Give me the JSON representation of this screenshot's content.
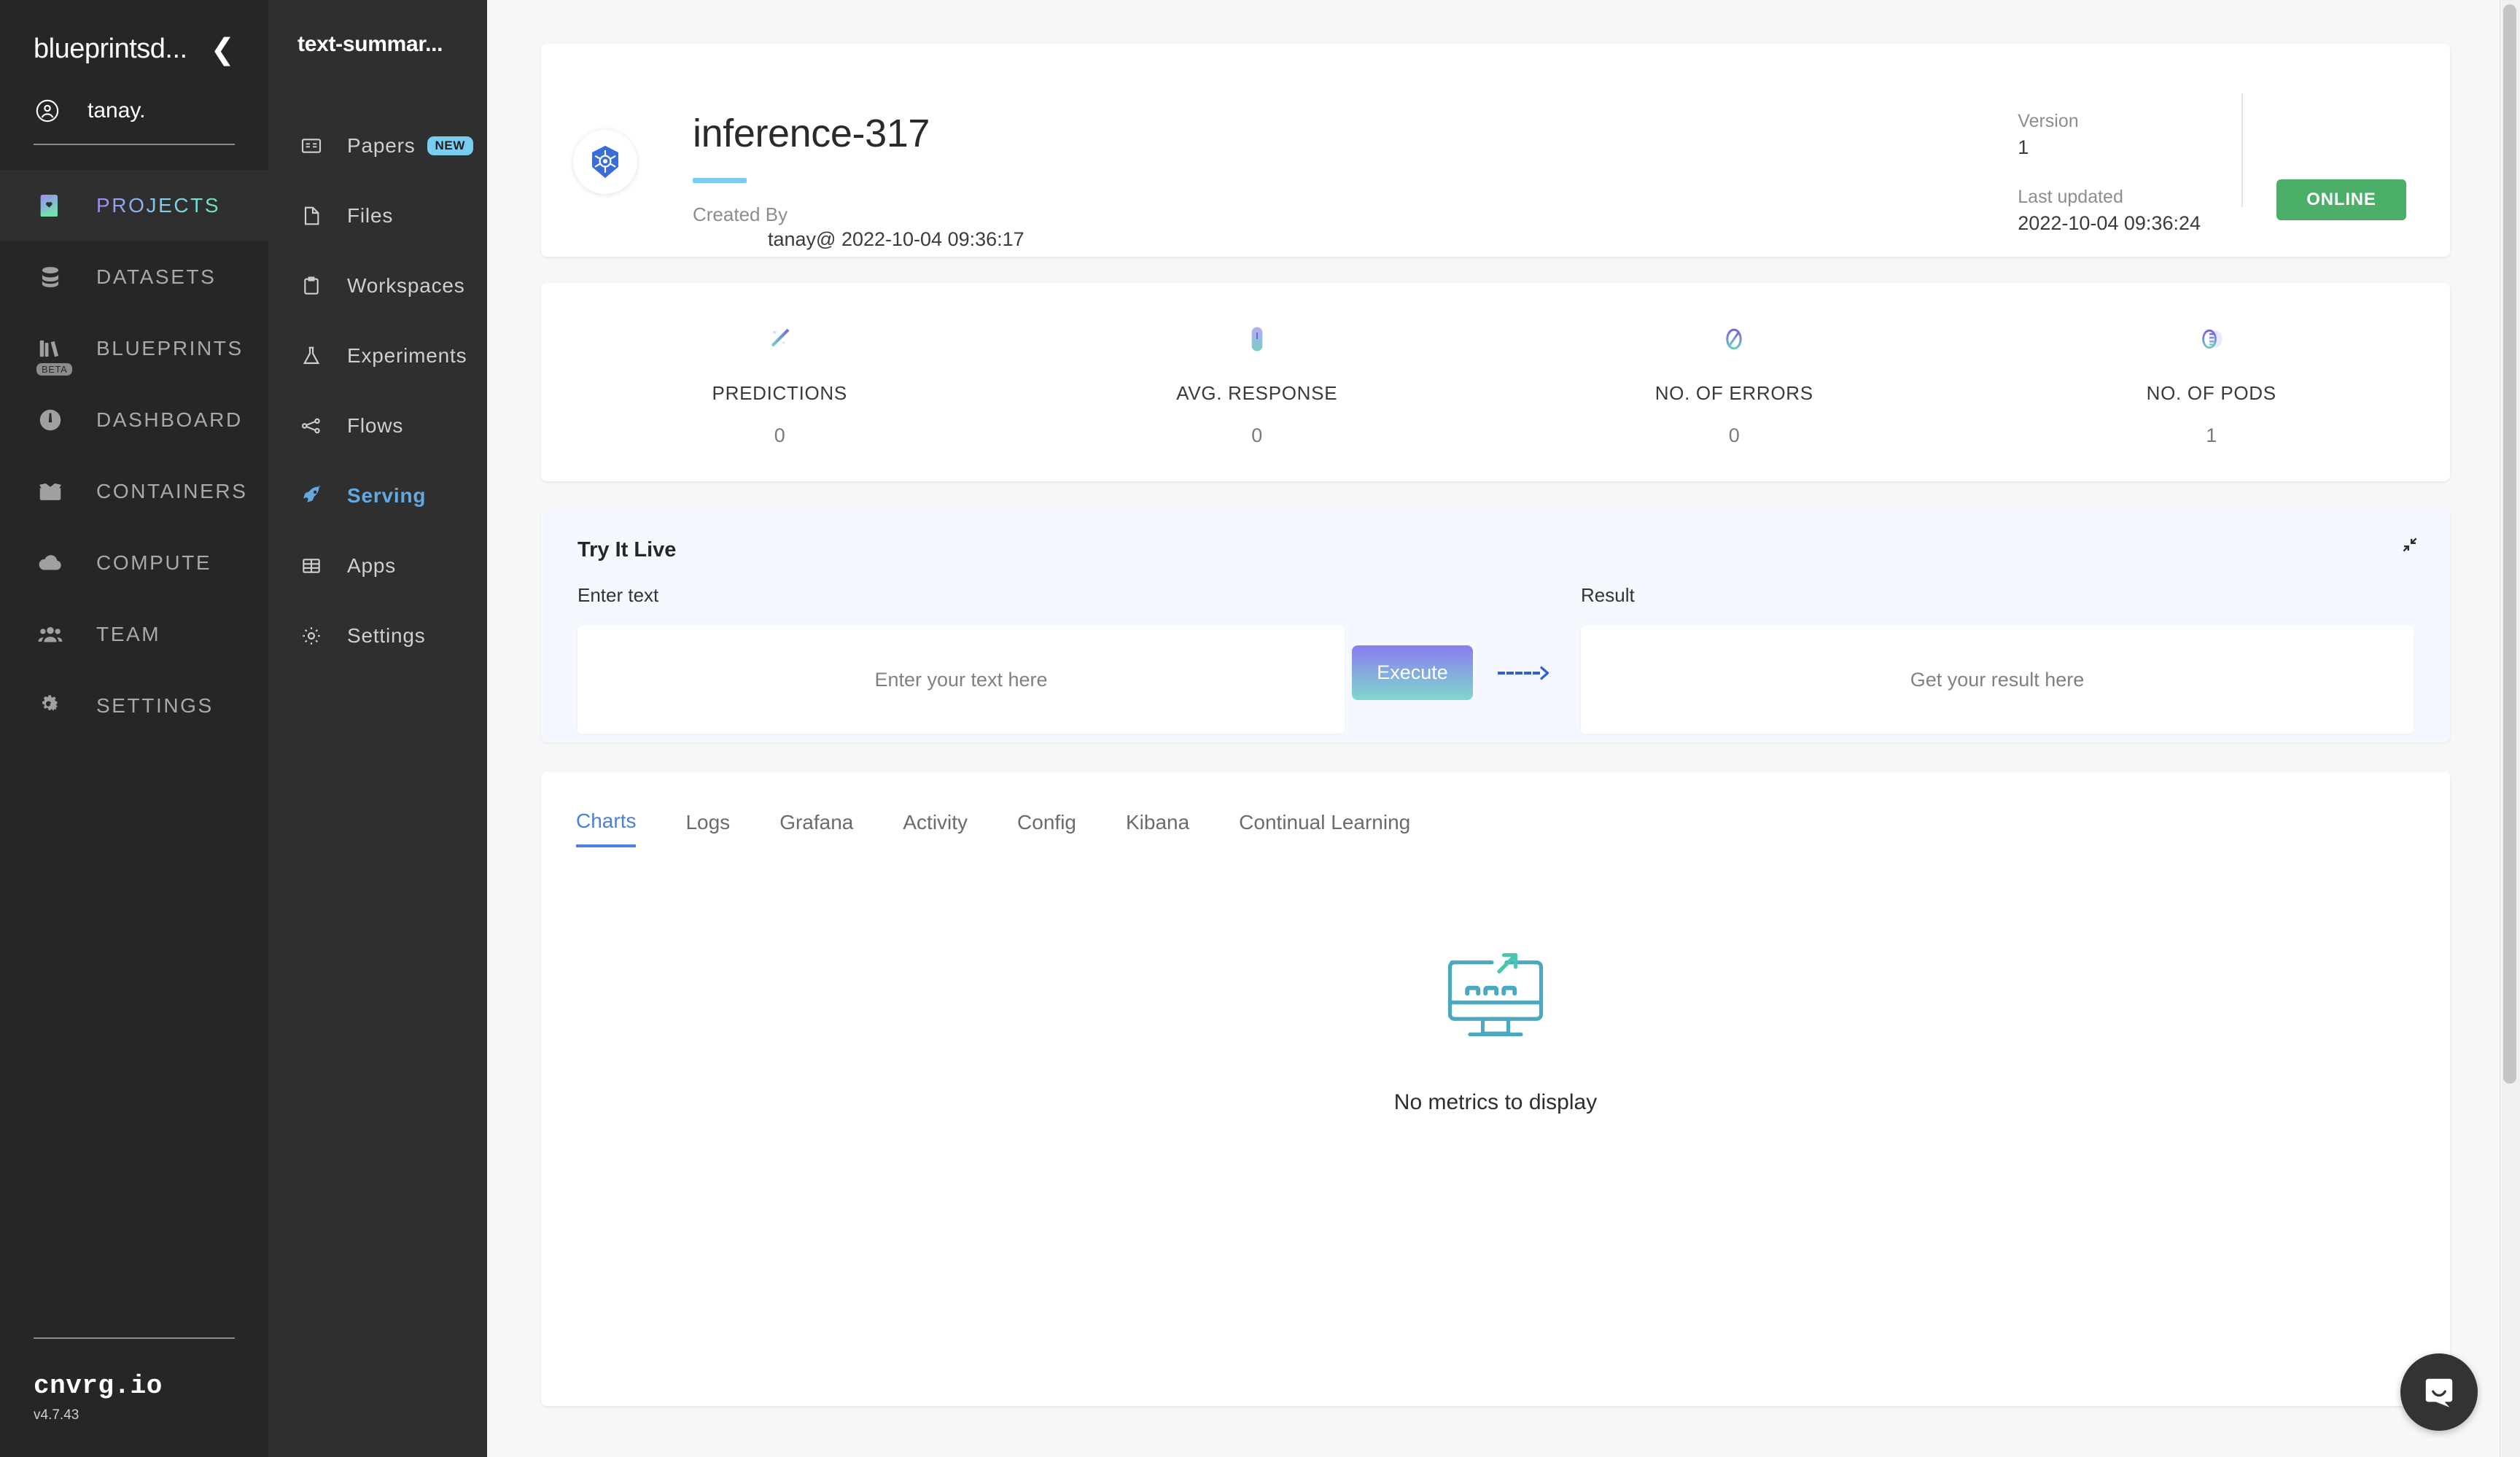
{
  "primary_sidebar": {
    "org_name": "blueprintsd...",
    "collapse_icon": "chevron-left-icon",
    "user_name": "tanay.",
    "items": [
      {
        "label": "PROJECTS",
        "icon": "book-heart-icon",
        "active": true,
        "badge": ""
      },
      {
        "label": "DATASETS",
        "icon": "database-icon",
        "active": false,
        "badge": ""
      },
      {
        "label": "BLUEPRINTS",
        "icon": "books-icon",
        "active": false,
        "badge": "BETA"
      },
      {
        "label": "DASHBOARD",
        "icon": "gauge-icon",
        "active": false,
        "badge": ""
      },
      {
        "label": "CONTAINERS",
        "icon": "box-icon",
        "active": false,
        "badge": ""
      },
      {
        "label": "COMPUTE",
        "icon": "cloud-icon",
        "active": false,
        "badge": ""
      },
      {
        "label": "TEAM",
        "icon": "people-icon",
        "active": false,
        "badge": ""
      },
      {
        "label": "SETTINGS",
        "icon": "gears-icon",
        "active": false,
        "badge": ""
      }
    ],
    "brand": "cnvrg.io",
    "version": "v4.7.43"
  },
  "secondary_sidebar": {
    "project_title": "text-summar...",
    "items": [
      {
        "label": "Papers",
        "icon": "papers-icon",
        "active": false,
        "badge": "NEW"
      },
      {
        "label": "Files",
        "icon": "file-icon",
        "active": false,
        "badge": ""
      },
      {
        "label": "Workspaces",
        "icon": "workspace-icon",
        "active": false,
        "badge": ""
      },
      {
        "label": "Experiments",
        "icon": "flask-icon",
        "active": false,
        "badge": ""
      },
      {
        "label": "Flows",
        "icon": "flow-icon",
        "active": false,
        "badge": ""
      },
      {
        "label": "Serving",
        "icon": "rocket-icon",
        "active": true,
        "badge": ""
      },
      {
        "label": "Apps",
        "icon": "grid-table-icon",
        "active": false,
        "badge": ""
      },
      {
        "label": "Settings",
        "icon": "gear-icon",
        "active": false,
        "badge": ""
      }
    ]
  },
  "header": {
    "avatar_icon": "kubernetes-icon",
    "title": "inference-317",
    "created_by_label": "Created By",
    "created_by_value": "tanay@ 2022-10-04 09:36:17",
    "version_label": "Version",
    "version_value": "1",
    "last_updated_label": "Last updated",
    "last_updated_value": "2022-10-04 09:36:24",
    "status": "ONLINE",
    "status_color": "#4caf68"
  },
  "stats": [
    {
      "label": "PREDICTIONS",
      "value": "0",
      "icon": "magic-wand-icon"
    },
    {
      "label": "AVG. RESPONSE",
      "value": "0",
      "icon": "stopwatch-icon"
    },
    {
      "label": "NO. OF ERRORS",
      "value": "0",
      "icon": "no-entry-icon"
    },
    {
      "label": "NO. OF PODS",
      "value": "1",
      "icon": "pods-icon"
    }
  ],
  "try_it_live": {
    "title": "Try It Live",
    "expand_icon": "collapse-arrows-icon",
    "input_label": "Enter text",
    "input_placeholder": "Enter your text  here",
    "input_value": "",
    "execute_label": "Execute",
    "arrow_icon": "dashed-arrow-right-icon",
    "result_label": "Result",
    "result_placeholder": "Get your result here",
    "result_value": ""
  },
  "tabs": {
    "items": [
      {
        "label": "Charts",
        "active": true
      },
      {
        "label": "Logs",
        "active": false
      },
      {
        "label": "Grafana",
        "active": false
      },
      {
        "label": "Activity",
        "active": false
      },
      {
        "label": "Config",
        "active": false
      },
      {
        "label": "Kibana",
        "active": false
      },
      {
        "label": "Continual Learning",
        "active": false
      }
    ],
    "empty_state": {
      "icon": "monitor-chart-icon",
      "text": "No metrics to display"
    }
  },
  "chat_widget": {
    "icon": "intercom-chat-icon"
  }
}
